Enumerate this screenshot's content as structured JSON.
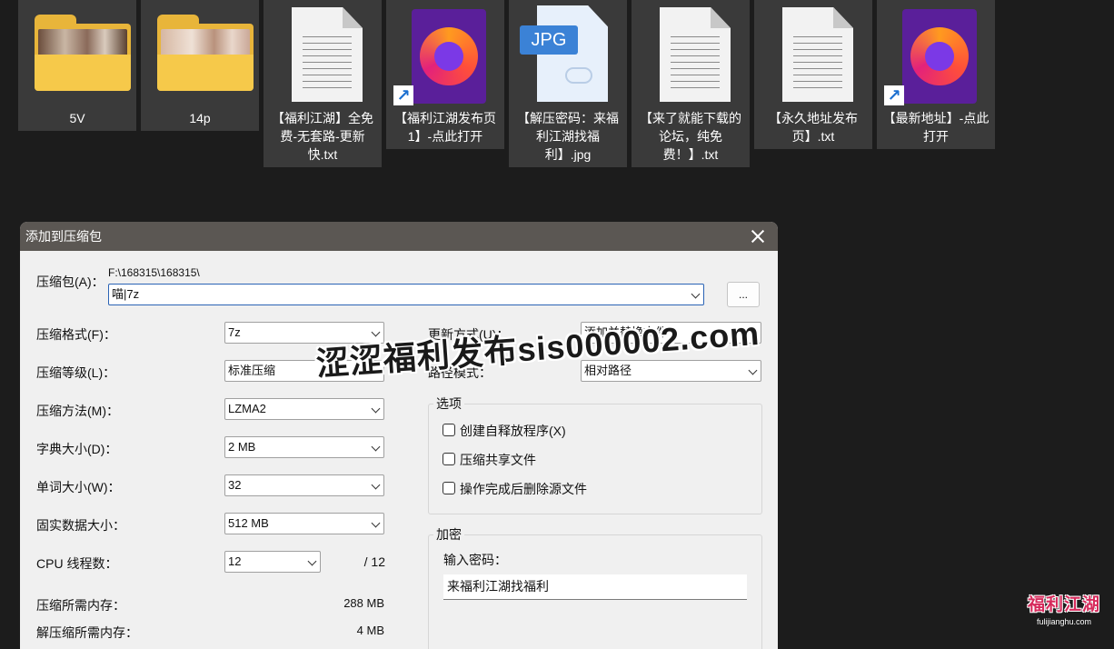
{
  "desktop": {
    "files": [
      {
        "label": "5V",
        "type": "folder"
      },
      {
        "label": "14p",
        "type": "folder"
      },
      {
        "label": "【福利江湖】全免费-无套路-更新快.txt",
        "type": "txt"
      },
      {
        "label": "【福利江湖发布页1】-点此打开",
        "type": "firefox-shortcut"
      },
      {
        "label": "【解压密码：来福利江湖找福利】.jpg",
        "type": "jpg",
        "badge": "JPG"
      },
      {
        "label": "【来了就能下载的论坛，纯免费！】.txt",
        "type": "txt"
      },
      {
        "label": "【永久地址发布页】.txt",
        "type": "txt"
      },
      {
        "label": "【最新地址】-点此打开",
        "type": "firefox-shortcut"
      }
    ]
  },
  "dialog": {
    "title": "添加到压缩包",
    "archive_label": "压缩包(A)：",
    "archive_path": "F:\\168315\\168315\\",
    "archive_name": "喵|7z",
    "browse_label": "...",
    "format_label": "压缩格式(F)：",
    "format_value": "7z",
    "level_label": "压缩等级(L)：",
    "level_value": "标准压缩",
    "method_label": "压缩方法(M)：",
    "method_value": "LZMA2",
    "dict_label": "字典大小(D)：",
    "dict_value": "2 MB",
    "word_label": "单词大小(W)：",
    "word_value": "32",
    "solid_label": "固实数据大小：",
    "solid_value": "512 MB",
    "cpu_label": "CPU 线程数：",
    "cpu_value": "12",
    "cpu_total": "/ 12",
    "mem_comp_label": "压缩所需内存：",
    "mem_comp_value": "288 MB",
    "mem_decomp_label": "解压缩所需内存：",
    "mem_decomp_value": "4 MB",
    "update_label": "更新方式(U)：",
    "update_value": "添加并替换文件",
    "path_label": "路径模式：",
    "path_value": "相对路径",
    "options_title": "选项",
    "options": [
      "创建自释放程序(X)",
      "压缩共享文件",
      "操作完成后删除源文件"
    ],
    "encrypt_title": "加密",
    "password_label": "输入密码：",
    "password_value": "来福利江湖找福利"
  },
  "overlay": {
    "watermark": "涩涩福利发布sis000002.com",
    "logo_main": "福利江湖",
    "logo_sub": "fulijianghu.com"
  },
  "colors": {
    "desktop_bg": "#1c1c1c",
    "tile_bg": "#3a3a3a",
    "titlebar": "#5b5753",
    "dialog_bg": "#f0f0f0",
    "focus_border": "#2a63b5",
    "logo": "#d62b5c"
  }
}
